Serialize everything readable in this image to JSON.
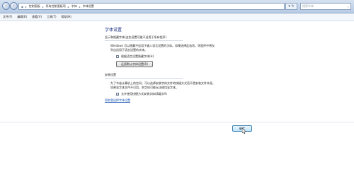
{
  "address": {
    "crumbs": [
      "控制面板",
      "所有控制面板项",
      "字体",
      "字体设置"
    ],
    "search_placeholder": "搜索字体"
  },
  "menu": [
    "文件(F)",
    "编辑(E)",
    "查看(V)",
    "工具(T)",
    "帮助(H)"
  ],
  "page": {
    "title": "字体设置",
    "section1": {
      "title": "显示和隐藏字体(这些设置可能不适用于所有程序)",
      "desc": "Windows 可以隐藏不适用于输入语言设置的字体。如果选择此选项，则程序中将仅列出适用于语言设置的字体。",
      "checkbox_label": "根据语言设置隐藏字体(H)",
      "checked": true,
      "button": "还原默认字体设置(R)"
    },
    "section2": {
      "title": "安装设置",
      "desc": "为了节省计算机上的空间，可以选择安装字体文件的快捷方式而不是安装文件本身。如果该字体文件不可用，则字体可能无法使用该字体。",
      "checkbox_label": "允许使用快捷方式安装字体(高级)(A)",
      "checked": true
    },
    "link": "帮助我选择字体设置"
  },
  "footer": {
    "ok": "确定"
  }
}
